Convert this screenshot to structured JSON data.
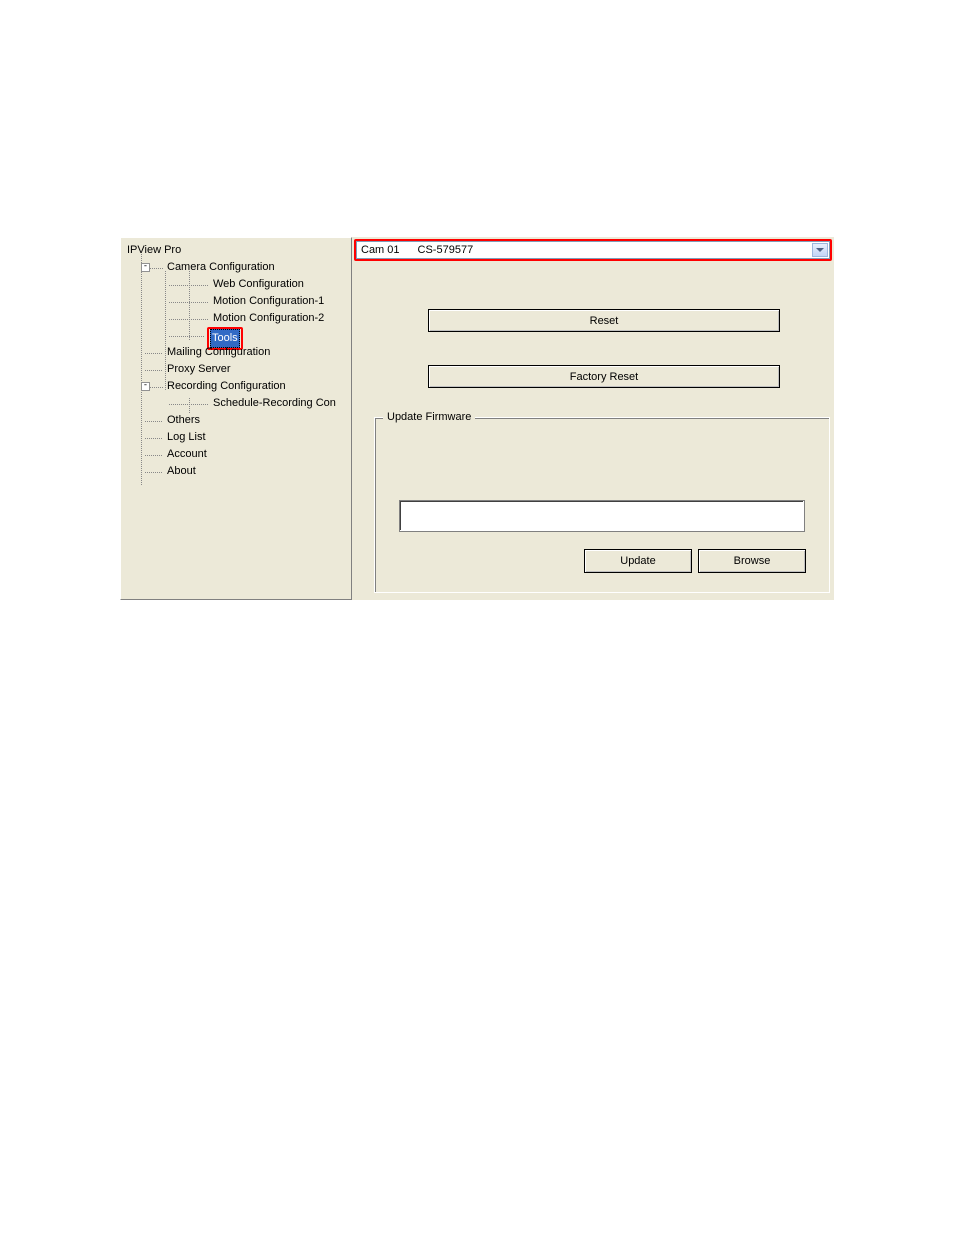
{
  "tree": {
    "root": "IPView Pro",
    "camera_config": "Camera Configuration",
    "web_config": "Web Configuration",
    "motion1": "Motion Configuration-1",
    "motion2": "Motion Configuration-2",
    "tools": "Tools",
    "mailing": "Mailing Configuration",
    "proxy": "Proxy Server",
    "recording_config": "Recording Configuration",
    "schedule_rec": "Schedule-Recording Con",
    "others": "Others",
    "log_list": "Log List",
    "account": "Account",
    "about": "About"
  },
  "dropdown": {
    "cam_label": "Cam 01",
    "cam_id": "CS-579577"
  },
  "buttons": {
    "reset": "Reset",
    "factory_reset": "Factory Reset",
    "update": "Update",
    "browse": "Browse"
  },
  "groupbox": {
    "title": "Update Firmware",
    "path": ""
  }
}
